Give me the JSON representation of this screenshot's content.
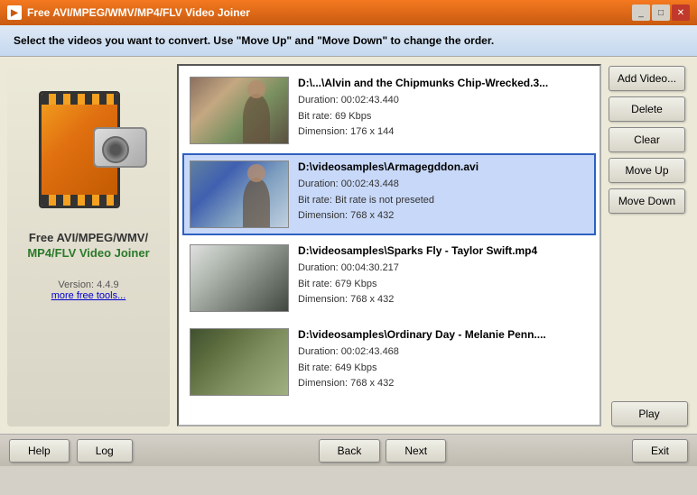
{
  "titleBar": {
    "title": "Free AVI/MPEG/WMV/MP4/FLV Video Joiner",
    "icon": "▶"
  },
  "instruction": "Select the videos you want to convert. Use \"Move Up\" and \"Move Down\" to change the order.",
  "leftPanel": {
    "appTitleLine1": "Free AVI/MPEG/WMV/",
    "appTitleLine2": "MP4/FLV Video Joiner",
    "version": "Version: 4.4.9",
    "moreTools": "more free tools..."
  },
  "videos": [
    {
      "name": "D:\\...\\Alvin and the Chipmunks Chip-Wrecked.3...",
      "duration": "Duration: 00:02:43.440",
      "bitrate": "Bit rate: 69 Kbps",
      "dimension": "Dimension: 176 x 144",
      "thumbClass": "thumb-1",
      "selected": false
    },
    {
      "name": "D:\\videosamples\\Armagegddon.avi",
      "duration": "Duration: 00:02:43.448",
      "bitrate": "Bit rate: Bit rate is not preseted",
      "dimension": "Dimension: 768 x 432",
      "thumbClass": "thumb-2",
      "selected": true
    },
    {
      "name": "D:\\videosamples\\Sparks Fly - Taylor Swift.mp4",
      "duration": "Duration: 00:04:30.217",
      "bitrate": "Bit rate: 679 Kbps",
      "dimension": "Dimension: 768 x 432",
      "thumbClass": "thumb-3",
      "selected": false
    },
    {
      "name": "D:\\videosamples\\Ordinary Day - Melanie Penn....",
      "duration": "Duration: 00:02:43.468",
      "bitrate": "Bit rate: 649 Kbps",
      "dimension": "Dimension: 768 x 432",
      "thumbClass": "thumb-4",
      "selected": false
    }
  ],
  "buttons": {
    "addVideo": "Add Video...",
    "delete": "Delete",
    "clear": "Clear",
    "moveUp": "Move Up",
    "moveDown": "Move Down",
    "play": "Play"
  },
  "bottomBar": {
    "help": "Help",
    "log": "Log",
    "back": "Back",
    "next": "Next",
    "exit": "Exit"
  }
}
